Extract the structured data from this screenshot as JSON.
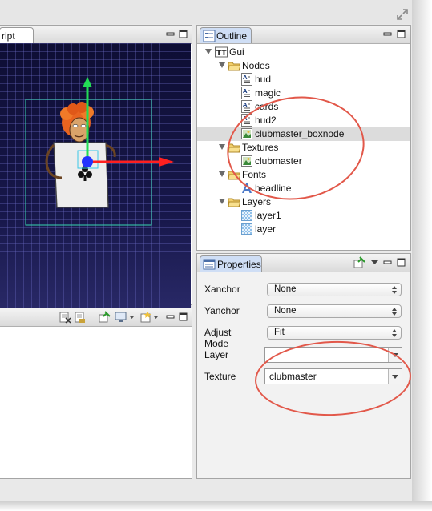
{
  "editor": {
    "tab_label": "ript"
  },
  "outline": {
    "tab_label": "Outline",
    "tree": [
      {
        "label": "Gui",
        "icon": "gui-icon",
        "level": 0,
        "expanded": true
      },
      {
        "label": "Nodes",
        "icon": "folder-icon",
        "level": 1,
        "expanded": true
      },
      {
        "label": "hud",
        "icon": "text-node-icon",
        "level": 2
      },
      {
        "label": "magic",
        "icon": "text-node-icon",
        "level": 2
      },
      {
        "label": "cards",
        "icon": "text-node-icon",
        "level": 2
      },
      {
        "label": "hud2",
        "icon": "text-node-icon",
        "level": 2
      },
      {
        "label": "clubmaster_boxnode",
        "icon": "box-node-icon",
        "level": 2,
        "selected": true
      },
      {
        "label": "Textures",
        "icon": "folder-icon",
        "level": 1,
        "expanded": true
      },
      {
        "label": "clubmaster",
        "icon": "texture-icon",
        "level": 2
      },
      {
        "label": "Fonts",
        "icon": "folder-icon",
        "level": 1,
        "expanded": true
      },
      {
        "label": "headline",
        "icon": "font-icon",
        "level": 2
      },
      {
        "label": "Layers",
        "icon": "folder-icon",
        "level": 1,
        "expanded": true
      },
      {
        "label": "layer1",
        "icon": "layer-icon",
        "level": 2
      },
      {
        "label": "layer",
        "icon": "layer-icon",
        "level": 2
      }
    ]
  },
  "properties": {
    "tab_label": "Properties",
    "xanchor": {
      "label": "Xanchor",
      "value": "None"
    },
    "yanchor": {
      "label": "Yanchor",
      "value": "None"
    },
    "adjust_mode": {
      "label": "Adjust Mode",
      "value": "Fit"
    },
    "layer": {
      "label": "Layer",
      "value": ""
    },
    "texture": {
      "label": "Texture",
      "value": "clubmaster"
    }
  },
  "colors": {
    "annotation": "#e2584a",
    "selection": "#dcdcdc",
    "gizmo_x": "#ff2020",
    "gizmo_y": "#22dd55",
    "gizmo_center": "#2233ff",
    "bounds": "#38d6b0"
  }
}
